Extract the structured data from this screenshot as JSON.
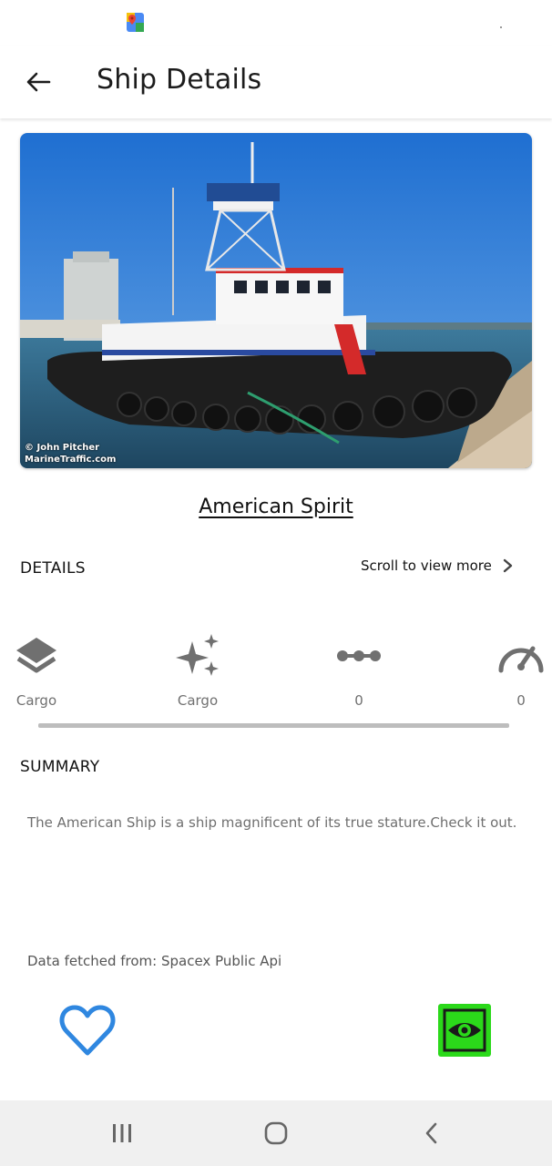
{
  "app_bar": {
    "title": "Ship Details"
  },
  "image": {
    "credit_line1": "© John Pitcher",
    "credit_line2": "MarineTraffic.com"
  },
  "ship": {
    "name": "American Spirit"
  },
  "details": {
    "heading": "DETAILS",
    "scroll_hint": "Scroll to view more",
    "items": [
      {
        "icon": "layers-icon",
        "label": "Cargo"
      },
      {
        "icon": "sparkles-icon",
        "label": "Cargo"
      },
      {
        "icon": "timeline-dots-icon",
        "label": "0"
      },
      {
        "icon": "speedometer-icon",
        "label": "0"
      }
    ]
  },
  "summary": {
    "heading": "SUMMARY",
    "text": "The American Ship is a ship magnificent of its true stature.Check it out."
  },
  "source": {
    "text": "Data fetched from: Spacex Public Api"
  },
  "colors": {
    "heart": "#2f87e0",
    "view_button": "#2bd91a",
    "icon_gray": "#707070"
  }
}
